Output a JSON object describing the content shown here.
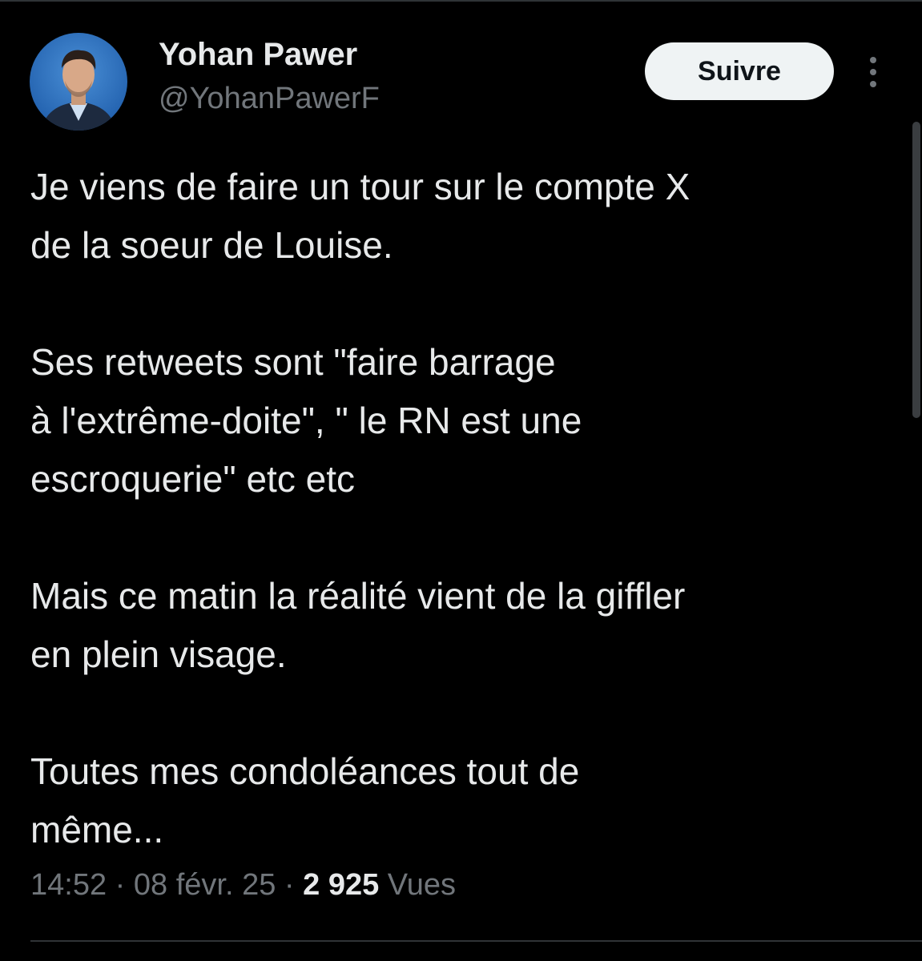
{
  "author": {
    "display_name": "Yohan Pawer",
    "handle": "@YohanPawerF",
    "avatar_icon": "profile-photo-icon"
  },
  "actions": {
    "follow_label": "Suivre",
    "more_icon": "more-vertical-icon"
  },
  "tweet": {
    "paragraphs": [
      [
        "Je viens de faire un tour sur le compte X",
        "de la soeur de Louise."
      ],
      [
        "Ses retweets sont \"faire barrage",
        "à l'extrême-doite\", \" le RN est une",
        "escroquerie\" etc etc"
      ],
      [
        "Mais ce matin la réalité vient de la giffler",
        "en plein visage."
      ],
      [
        "Toutes mes condoléances tout de",
        "même..."
      ]
    ]
  },
  "meta": {
    "time": "14:52",
    "separator": "·",
    "date": "08 févr. 25",
    "views_count": "2 925",
    "views_label": "Vues"
  },
  "colors": {
    "background": "#000000",
    "text_primary": "#e7e9ea",
    "text_secondary": "#71767b",
    "button_bg": "#eff3f4",
    "divider": "#2f3336"
  }
}
